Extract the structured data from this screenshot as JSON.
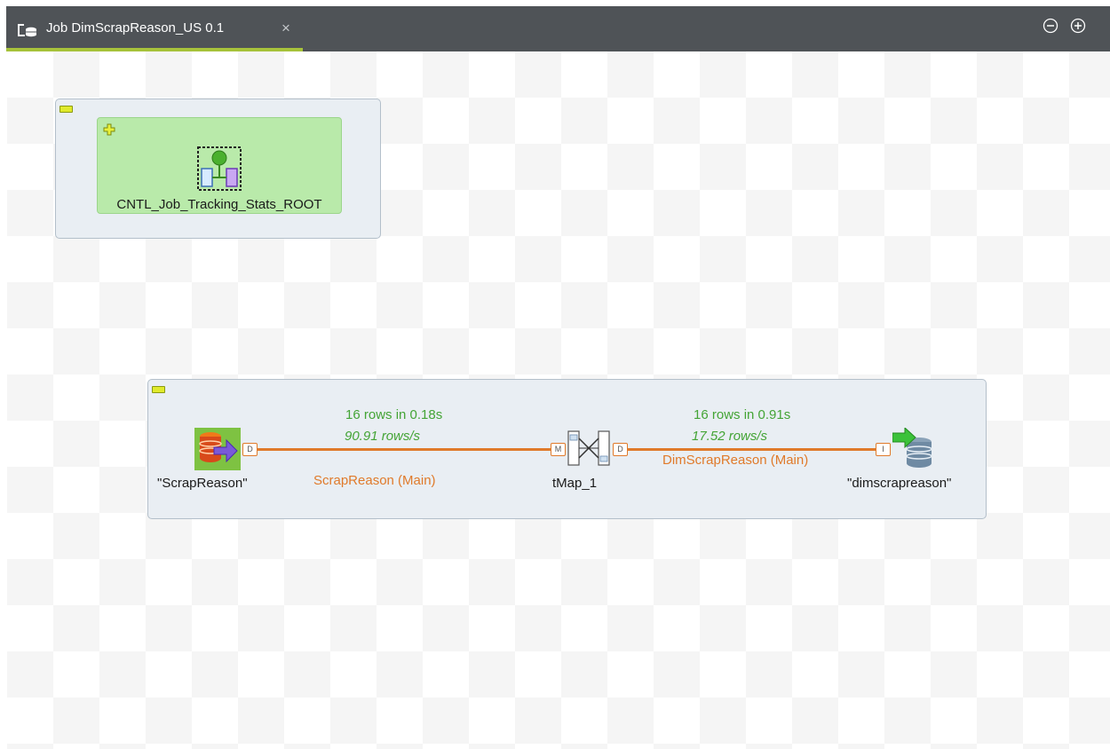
{
  "tab": {
    "title": "Job DimScrapReason_US 0.1",
    "close_glyph": "×",
    "icon": "job-design-icon",
    "active_underline_color": "#a6c23a"
  },
  "window_controls": {
    "minimize_icon": "zoom-out-icon",
    "maximize_icon": "zoom-in-icon"
  },
  "subjob_root": {
    "component": {
      "label": "CNTL_Job_Tracking_Stats_ROOT",
      "icon": "tracking-stats-icon"
    }
  },
  "subjob_main": {
    "source": {
      "label": "\"ScrapReason\"",
      "icon": "db-input-icon",
      "port": "D"
    },
    "map": {
      "label": "tMap_1",
      "icon": "tmap-icon",
      "in_port": "M",
      "out_port": "D"
    },
    "target": {
      "label": "\"dimscrapreason\"",
      "icon": "db-output-icon",
      "port": "I"
    },
    "link1": {
      "stats": "16 rows in 0.18s",
      "rate": "90.91 rows/s",
      "name": "ScrapReason (Main)"
    },
    "link2": {
      "stats": "16 rows in 0.91s",
      "rate": "17.52 rows/s",
      "name": "DimScrapReason (Main)"
    }
  },
  "colors": {
    "tab_bar": "#4f5357",
    "link": "#e07a2a",
    "stats_text": "#44a436",
    "subjob_green": "#b9eaaa"
  }
}
